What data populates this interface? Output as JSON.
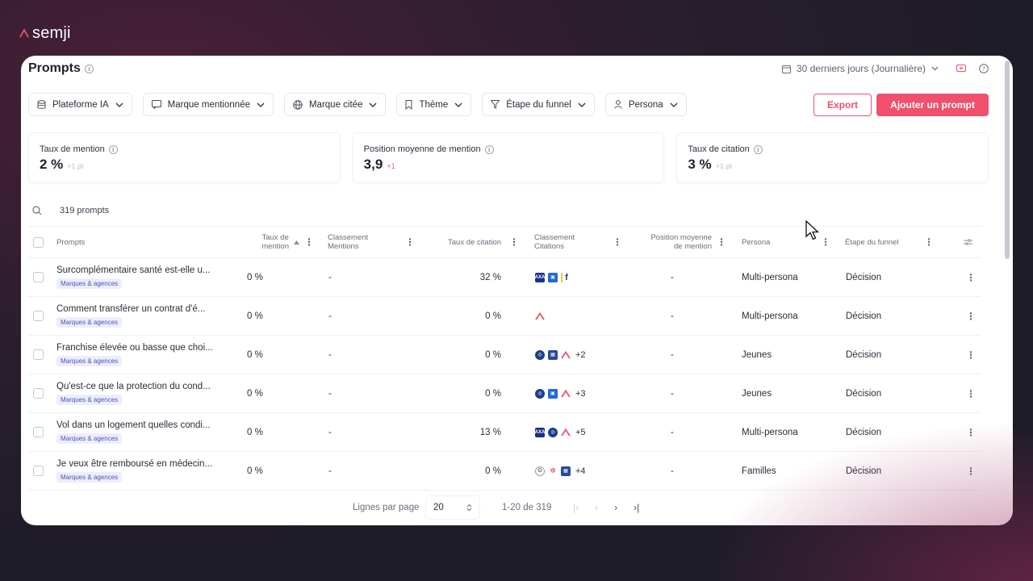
{
  "brand": {
    "name": "semji"
  },
  "header": {
    "title": "Prompts",
    "date_range": "30 derniers jours (Journalière)"
  },
  "filters": [
    {
      "label": "Plateforme IA",
      "icon": "database-icon"
    },
    {
      "label": "Marque mentionnée",
      "icon": "message-icon"
    },
    {
      "label": "Marque citée",
      "icon": "globe-icon"
    },
    {
      "label": "Thème",
      "icon": "bookmark-icon"
    },
    {
      "label": "Étape du funnel",
      "icon": "funnel-icon"
    },
    {
      "label": "Persona",
      "icon": "user-icon"
    }
  ],
  "actions": {
    "export": "Export",
    "add": "Ajouter un prompt"
  },
  "kpis": [
    {
      "label": "Taux de mention",
      "value": "2 %",
      "delta": "+1 pt"
    },
    {
      "label": "Position moyenne de mention",
      "value": "3,9",
      "delta": "+1"
    },
    {
      "label": "Taux de citation",
      "value": "3 %",
      "delta": "+1 pt"
    }
  ],
  "search": {
    "count": "319 prompts"
  },
  "table": {
    "headers": {
      "prompts": "Prompts",
      "taux_mention_1": "Taux de",
      "taux_mention_2": "mention",
      "classement_mentions_1": "Classement",
      "classement_mentions_2": "Mentions",
      "taux_citation": "Taux de citation",
      "classement_citations_1": "Classement",
      "classement_citations_2": "Citations",
      "position_1": "Position moyenne",
      "position_2": "de mention",
      "persona": "Persona",
      "etape": "Étape du funnel"
    },
    "rows": [
      {
        "prompt": "Surcomplémentaire santé est-elle u...",
        "tag": "Marques & agences",
        "taux_mention": "0 %",
        "classement_mentions": "-",
        "taux_citation": "32 %",
        "icons": [
          "axa",
          "blue",
          "f"
        ],
        "more": "",
        "position": "-",
        "persona": "Multi-persona",
        "etape": "Décision"
      },
      {
        "prompt": "Comment transférer un contrat d'é...",
        "tag": "Marques & agences",
        "taux_mention": "0 %",
        "classement_mentions": "-",
        "taux_citation": "0 %",
        "icons": [
          "semji"
        ],
        "more": "",
        "position": "-",
        "persona": "Multi-persona",
        "etape": "Décision"
      },
      {
        "prompt": "Franchise élevée ou basse que choi...",
        "tag": "Marques & agences",
        "taux_mention": "0 %",
        "classement_mentions": "-",
        "taux_citation": "0 %",
        "icons": [
          "circle",
          "grid",
          "semji"
        ],
        "more": "+2",
        "position": "-",
        "persona": "Jeunes",
        "etape": "Décision"
      },
      {
        "prompt": "Qu'est-ce que la protection du cond...",
        "tag": "Marques & agences",
        "taux_mention": "0 %",
        "classement_mentions": "-",
        "taux_citation": "0 %",
        "icons": [
          "circle",
          "blue",
          "semji"
        ],
        "more": "+3",
        "position": "-",
        "persona": "Jeunes",
        "etape": "Décision"
      },
      {
        "prompt": "Vol dans un logement quelles condi...",
        "tag": "Marques & agences",
        "taux_mention": "0 %",
        "classement_mentions": "-",
        "taux_citation": "13 %",
        "icons": [
          "axa",
          "circle",
          "semji"
        ],
        "more": "+5",
        "position": "-",
        "persona": "Multi-persona",
        "etape": "Décision"
      },
      {
        "prompt": "Je veux être remboursé en médecin...",
        "tag": "Marques & agences",
        "taux_mention": "0 %",
        "classement_mentions": "-",
        "taux_citation": "0 %",
        "icons": [
          "g",
          "star",
          "grid"
        ],
        "more": "+4",
        "position": "-",
        "persona": "Familles",
        "etape": "Décision"
      }
    ]
  },
  "pagination": {
    "label": "Lignes par page",
    "per_page": "20",
    "range": "1-20 de 319"
  },
  "colors": {
    "accent": "#f0506c",
    "tag_bg": "#eceefc",
    "tag_text": "#4b53b8"
  }
}
